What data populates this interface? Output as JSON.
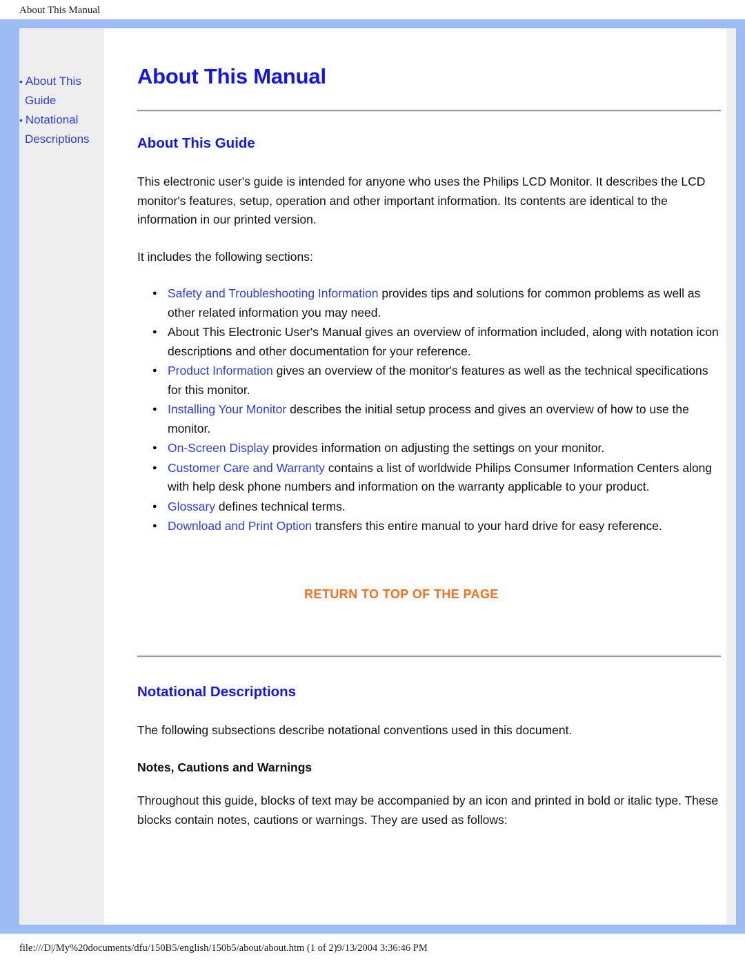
{
  "print_header": "About This Manual",
  "print_footer": "file:///D|/My%20documents/dfu/150B5/english/150b5/about/about.htm (1 of 2)9/13/2004 3:36:46 PM",
  "colors": {
    "frame_blue": "#9dbbf5",
    "link_blue": "#2a3de8",
    "heading_blue": "#1414ee",
    "return_orange": "#f57120",
    "sidebar_gray": "#eeeeee"
  },
  "sidebar": {
    "bullet": "•",
    "items": [
      {
        "label": "About This Guide"
      },
      {
        "label": "Notational Descriptions"
      }
    ]
  },
  "main": {
    "title": "About This Manual",
    "section1": {
      "heading": "About This Guide",
      "paragraph1": "This electronic user's guide is intended for anyone who uses the Philips LCD Monitor. It describes the LCD monitor's features, setup, operation and other important information. Its contents are identical to the information in our printed version.",
      "paragraph2": "It includes the following sections:",
      "bullets": [
        {
          "link": "Safety and Troubleshooting Information",
          "text": " provides tips and solutions for common problems as well as other related information you may need."
        },
        {
          "link": "",
          "text": "About This Electronic User's Manual gives an overview of information included, along with notation icon descriptions and other documentation for your reference."
        },
        {
          "link": "Product Information",
          "text": " gives an overview of the monitor's features as well as the technical specifications for this monitor."
        },
        {
          "link": "Installing Your Monitor",
          "text": " describes the initial setup process and gives an overview of how to use the monitor."
        },
        {
          "link": "On-Screen Display",
          "text": " provides information on adjusting the settings on your monitor."
        },
        {
          "link": "Customer Care and Warranty",
          "text": " contains a list of worldwide Philips Consumer Information Centers along with help desk phone numbers and information on the warranty applicable to your product."
        },
        {
          "link": "Glossary",
          "text": " defines technical terms."
        },
        {
          "link": "Download and Print Option",
          "text": " transfers this entire manual to your hard drive for easy reference."
        }
      ],
      "return_to_top": "RETURN TO TOP OF THE PAGE"
    },
    "section2": {
      "heading": "Notational Descriptions",
      "paragraph1": "The following subsections describe notational conventions used in this document.",
      "subheading": "Notes, Cautions and Warnings",
      "paragraph2": "Throughout this guide, blocks of text may be accompanied by an icon and printed in bold or italic type. These blocks contain notes, cautions or warnings. They are used as follows:"
    }
  }
}
